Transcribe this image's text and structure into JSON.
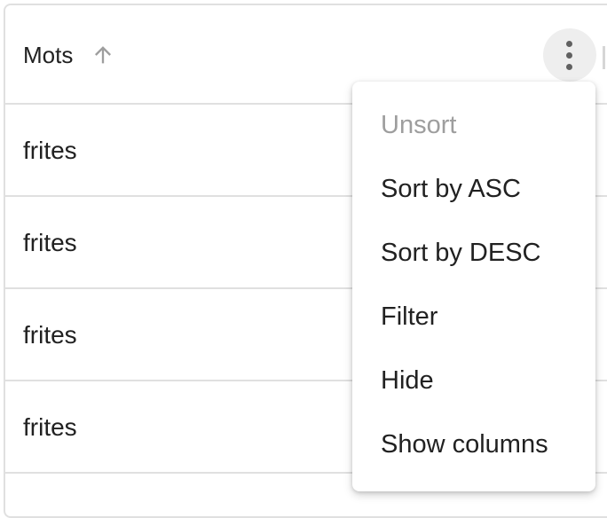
{
  "column": {
    "title": "Mots",
    "sort_icon": "arrow-up-icon",
    "menu_icon": "more-vertical-icon"
  },
  "rows": [
    {
      "value": "frites"
    },
    {
      "value": "frites"
    },
    {
      "value": "frites"
    },
    {
      "value": "frites"
    }
  ],
  "menu": {
    "items": [
      {
        "label": "Unsort",
        "disabled": true
      },
      {
        "label": "Sort by ASC",
        "disabled": false
      },
      {
        "label": "Sort by DESC",
        "disabled": false
      },
      {
        "label": "Filter",
        "disabled": false
      },
      {
        "label": "Hide",
        "disabled": false
      },
      {
        "label": "Show columns",
        "disabled": false
      }
    ]
  }
}
